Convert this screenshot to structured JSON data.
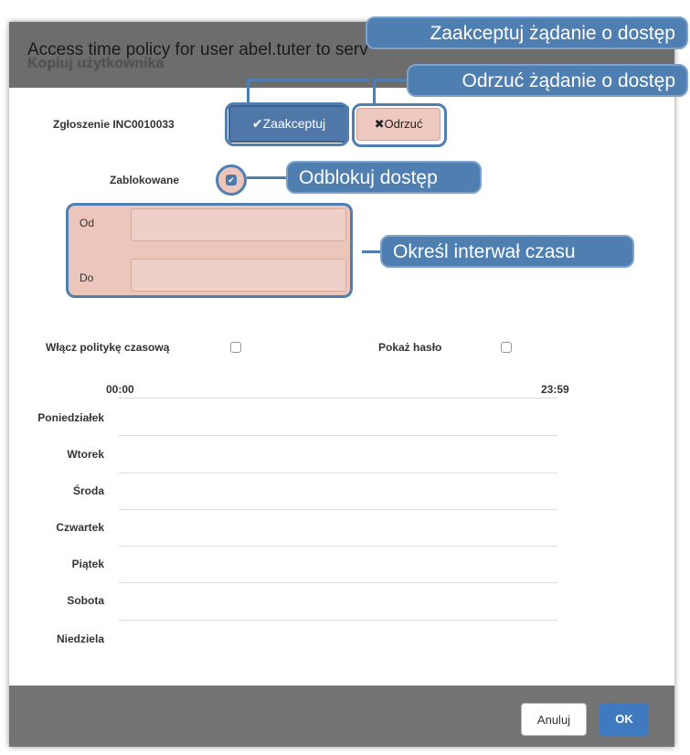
{
  "dialog": {
    "title": "Access time policy for user abel.tuter to serv",
    "ghost_text": "Kopiuj użytkownika"
  },
  "request": {
    "label": "Zgłoszenie INC0010033",
    "accept_label": "✔Zaakceptuj",
    "reject_label": "✖Odrzuć"
  },
  "blocked": {
    "label": "Zablokowane",
    "checked": true
  },
  "interval": {
    "from_label": "Od",
    "to_label": "Do",
    "from_value": "",
    "to_value": ""
  },
  "options": {
    "time_policy_label": "Włącz politykę czasową",
    "show_password_label": "Pokaż hasło"
  },
  "timeline": {
    "start": "00:00",
    "end": "23:59",
    "days": [
      "Poniedziałek",
      "Wtorek",
      "Środa",
      "Czwartek",
      "Piątek",
      "Sobota",
      "Niedziela"
    ]
  },
  "footer": {
    "cancel_label": "Anuluj",
    "ok_label": "OK"
  },
  "callouts": {
    "accept": "Zaakceptuj żądanie o dostęp",
    "reject": "Odrzuć żądanie o dostęp",
    "unblock": "Odblokuj dostęp",
    "interval": "Określ interwał czasu"
  },
  "colors": {
    "accent": "#4f7fb0",
    "highlight": "#ecc5bb",
    "ok": "#3f7ac0"
  }
}
